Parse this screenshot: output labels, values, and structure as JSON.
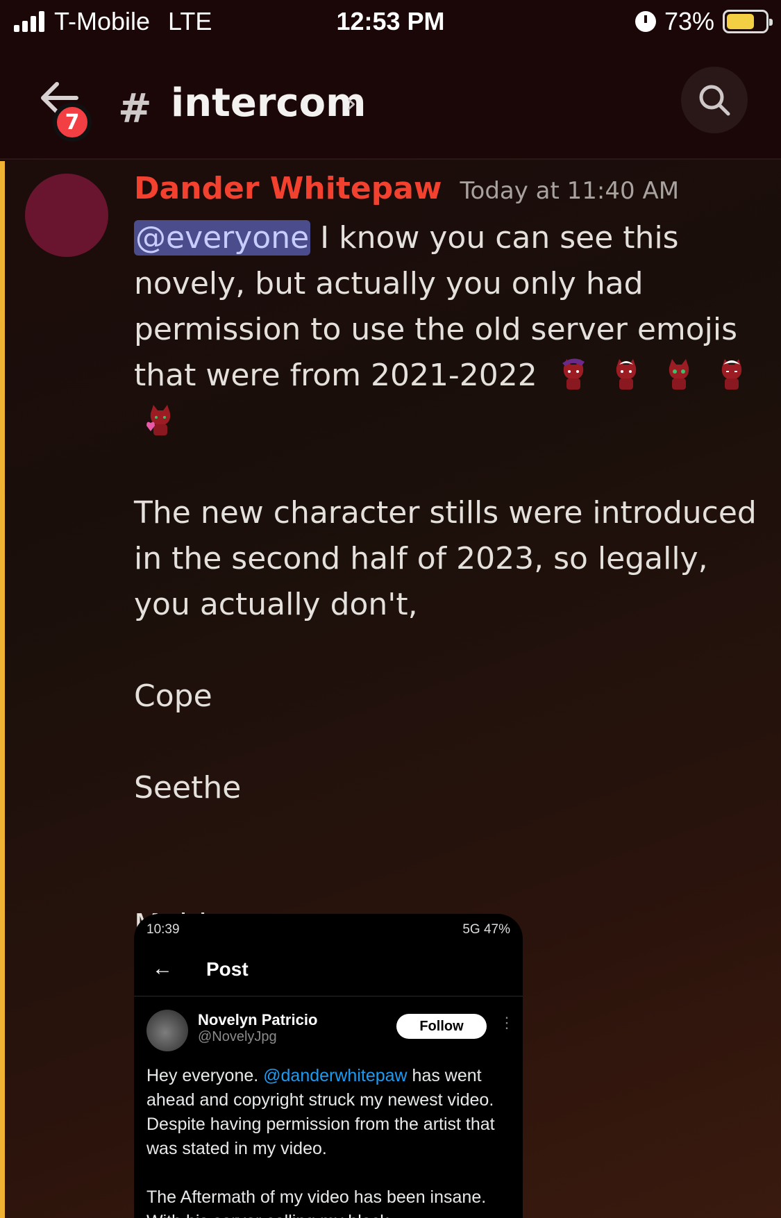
{
  "status_bar": {
    "carrier": "T-Mobile",
    "network": "LTE",
    "time": "12:53 PM",
    "battery": "73%",
    "battery_level": 0.73
  },
  "header": {
    "back_badge": "7",
    "channel_name": "intercom",
    "chevron": "›"
  },
  "message": {
    "author": "Dander Whitepaw",
    "author_color": "#f2412e",
    "timestamp": "Today at 11:40 AM",
    "mention": "@everyone",
    "line1": " I know you can see this novely, but actually you only had permission to use the old server emojis that were from 2021-2022",
    "emojis": [
      "cat-emoji-1",
      "cat-emoji-2",
      "cat-emoji-3",
      "cat-emoji-4",
      "cat-emoji-5"
    ],
    "para2": "The new character stills were introduced in the second half of 2023, so legally, you actually don't,",
    "cope": "Cope",
    "seethe": "Seethe",
    "mald": "Mald"
  },
  "embed": {
    "status_time": "10:39",
    "status_right": "5G 47%",
    "back_arrow": "←",
    "title": "Post",
    "name": "Novelyn Patricio",
    "handle": "@NovelyJpg",
    "follow": "Follow",
    "more": "⋮",
    "text_start": "Hey everyone. ",
    "text_mention": "@danderwhitepaw",
    "text_end": " has went ahead and copyright struck my newest video. Despite having permission from the artist that was stated in my video.",
    "text2": "The Aftermath of my video has been insane. With his server calling my black"
  },
  "colors": {
    "accent_bar": "#f0b232",
    "mention_bg": "#4a4c8c",
    "badge": "#f23f43"
  }
}
